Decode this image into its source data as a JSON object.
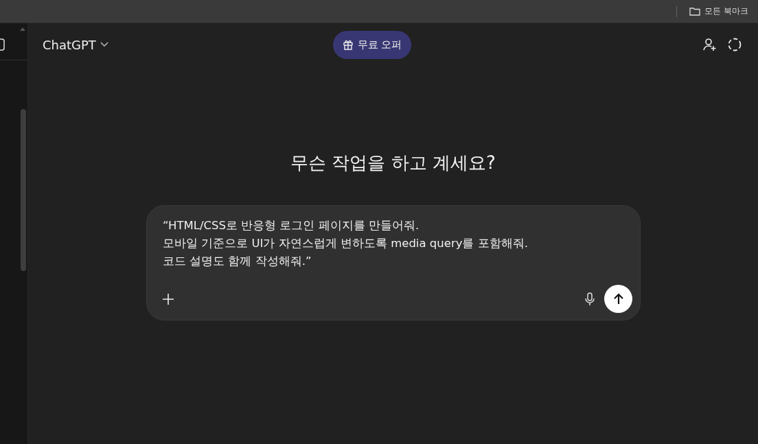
{
  "bookmarks_bar": {
    "folder": "모든 북마크"
  },
  "header": {
    "model": "ChatGPT",
    "offer": "무료 오퍼"
  },
  "heading": "무슨 작업을 하고 계세요?",
  "composer": {
    "value": "“HTML/CSS로 반응형 로그인 페이지를 만들어줘.\n모바일 기준으로 UI가 자연스럽게 변하도록 media query를 포함해줘.\n코드 설명도 함께 작성해줘.”"
  }
}
